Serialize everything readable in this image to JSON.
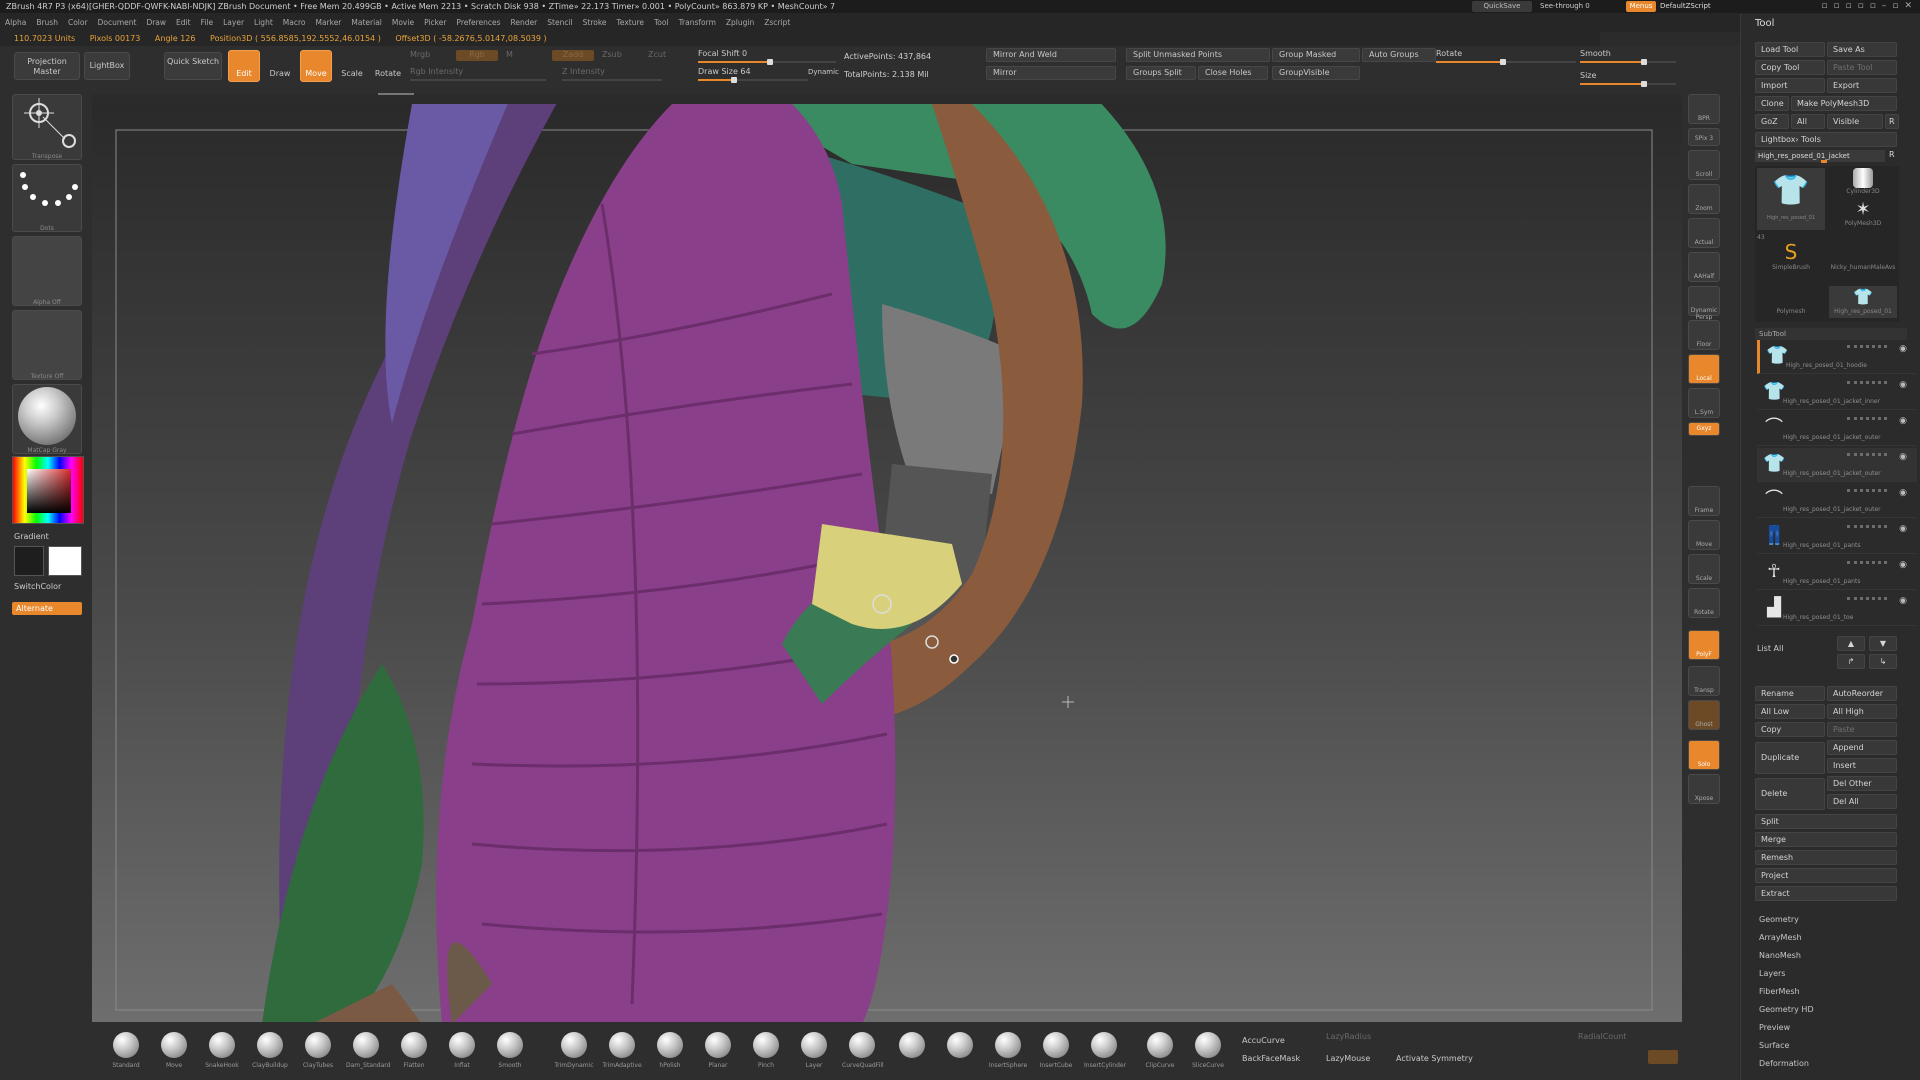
{
  "titlebar": {
    "text": "ZBrush 4R7 P3 (x64)[GHER-QDDF-QWFK-NABI-NDJK]   ZBrush Document      • Free Mem 20.499GB • Active Mem 2213 • Scratch Disk 938 • ZTime» 22.173 Timer» 0.001 • PolyCount» 863.879 KP • MeshCount» 7",
    "quicksave": "QuickSave",
    "see_through": "See-through  0",
    "menus": "Menus",
    "default_zscript": "DefaultZScript"
  },
  "menubar": [
    "Alpha",
    "Brush",
    "Color",
    "Document",
    "Draw",
    "Edit",
    "File",
    "Layer",
    "Light",
    "Macro",
    "Marker",
    "Material",
    "Movie",
    "Picker",
    "Preferences",
    "Render",
    "Stencil",
    "Stroke",
    "Texture",
    "Tool",
    "Transform",
    "Zplugin",
    "Zscript"
  ],
  "statusline": {
    "units": "110.7023 Units",
    "pixols": "Pixols 00173",
    "angle": "Angle 126",
    "position3d": "Position3D ( 556.8585,192.5552,46.0154 )",
    "offset3d": "Offset3D ( -58.2676,5.0147,08.5039 )"
  },
  "topshelf": {
    "projection_master": "Projection Master",
    "lightbox": "LightBox",
    "quick_sketch": "Quick Sketch",
    "edit": "Edit",
    "draw": "Draw",
    "move": "Move",
    "scale": "Scale",
    "rotate": "Rotate",
    "mrgb": "Mrgb",
    "rgb": "Rgb",
    "m": "M",
    "zadd": "Zadd",
    "zsub": "Zsub",
    "zcut": "Zcut",
    "rgb_intensity": "Rgb Intensity",
    "z_intensity": "Z Intensity",
    "focal_shift": "Focal Shift 0",
    "draw_size": "Draw Size 64",
    "dynamic": "Dynamic",
    "active_points": "ActivePoints: 437,864",
    "total_points": "TotalPoints: 2.138 Mil",
    "mirror_and_weld": "Mirror And Weld",
    "mirror": "Mirror",
    "split_unmasked": "Split Unmasked Points",
    "groups_split": "Groups Split",
    "close_holes": "Close Holes",
    "group_masked": "Group Masked",
    "auto_groups": "Auto Groups",
    "group_visible": "GroupVisible",
    "rotate_slider": "Rotate",
    "smooth": "Smooth",
    "size": "Size"
  },
  "lefttray": {
    "transpose": "Transpose",
    "dots": "Dots",
    "alpha_off": "Alpha Off",
    "texture_off": "Texture Off",
    "matcap": "MatCap Gray",
    "gradient": "Gradient",
    "switchcolor": "SwitchColor",
    "alternate": "Alternate",
    "main_color": "#d62a2a",
    "secondary_color": "#ffffff"
  },
  "rightshelf": [
    "BPR",
    "SPix 3",
    "Scroll",
    "Zoom",
    "Actual",
    "AAHalf",
    "Dynamic Persp",
    "Floor",
    "Local",
    "L.Sym",
    "Gxyz",
    "Frame",
    "Move",
    "Scale",
    "Rotate",
    "PolyF",
    "Transp",
    "Ghost",
    "Solo",
    "Xpose"
  ],
  "toolpanel": {
    "title": "Tool",
    "load_tool": "Load Tool",
    "save_as": "Save As",
    "copy_tool": "Copy Tool",
    "paste_tool": "Paste Tool",
    "import": "Import",
    "export": "Export",
    "clone": "Clone",
    "make_polymesh": "Make PolyMesh3D",
    "goz": "GoZ",
    "all": "All",
    "visible": "Visible",
    "r": "R",
    "lightbox_tools": "Lightbox› Tools",
    "current_tool": "High_res_posed_01_jacket",
    "thumbs": [
      "High_res_posed_01",
      "Cylinder3D",
      "PolyMesh3D",
      "SimpleBrush",
      "Nicky_humanMaleAvs",
      "Polymesh",
      "High_res_posed_01"
    ],
    "thumb_count": "43",
    "subtool_header": "SubTool",
    "subtools": [
      "High_res_posed_01_hoodie",
      "High_res_posed_01_jacket_inner",
      "High_res_posed_01_jacket_outer",
      "High_res_posed_01_jacket_outer",
      "High_res_posed_01_jacket_outer",
      "High_res_posed_01_pants",
      "High_res_posed_01_pants",
      "High_res_posed_01_toe"
    ],
    "list_all": "List All",
    "rename": "Rename",
    "autoreorder": "AutoReorder",
    "all_low": "All Low",
    "all_high": "All High",
    "copy": "Copy",
    "paste": "Paste",
    "duplicate": "Duplicate",
    "append": "Append",
    "insert": "Insert",
    "delete": "Delete",
    "del_other": "Del Other",
    "del_all": "Del All",
    "split": "Split",
    "merge": "Merge",
    "remesh": "Remesh",
    "project": "Project",
    "extract": "Extract",
    "sections": [
      "Geometry",
      "ArrayMesh",
      "NanoMesh",
      "Layers",
      "FiberMesh",
      "Geometry HD",
      "Preview",
      "Surface",
      "Deformation"
    ]
  },
  "bottomshelf": {
    "brushes": [
      "Standard",
      "Move",
      "SnakeHook",
      "ClayBuildup",
      "ClayTubes",
      "Dam_Standard",
      "Flatten",
      "Inflat",
      "Smooth",
      "TrimDynamic",
      "TrimAdaptive",
      "hPolish",
      "Planar",
      "Pinch",
      "Layer",
      "CurveQuadFill",
      "",
      "",
      "InsertSphere",
      "InsertCube",
      "InsertCylinder",
      "ClipCurve",
      "SliceCurve"
    ],
    "accucurve": "AccuCurve",
    "backfacemask": "BackFaceMask",
    "lazyradius": "LazyRadius",
    "lazymouse": "LazyMouse",
    "activate_symmetry": "Activate Symmetry",
    "radialcount": "RadialCount"
  }
}
